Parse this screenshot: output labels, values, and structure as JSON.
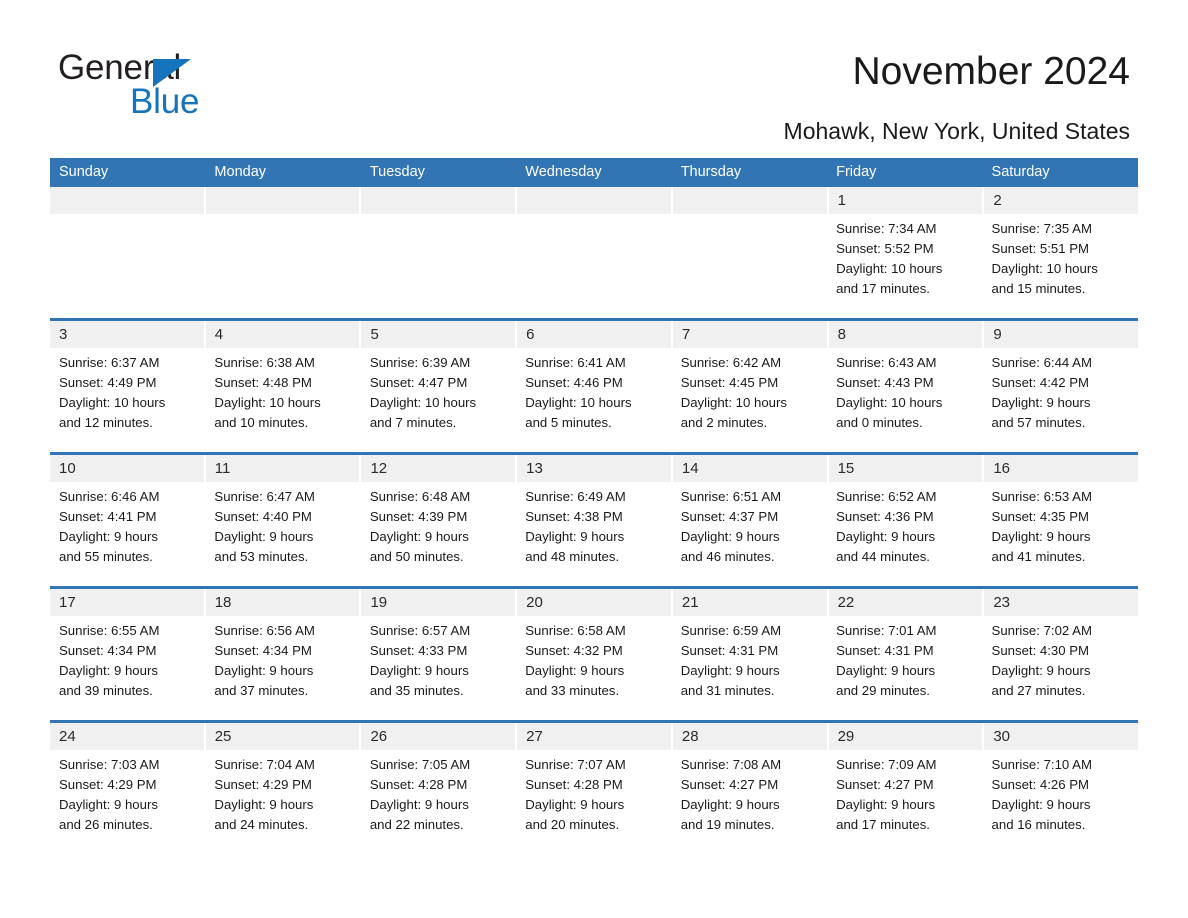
{
  "logo": {
    "primary_text": "General",
    "secondary_text": "Blue",
    "triangle_icon": "triangle-icon",
    "primary_color": "#231f20",
    "secondary_color": "#1574bb"
  },
  "header": {
    "title": "November 2024",
    "subtitle": "Mohawk, New York, United States"
  },
  "colors": {
    "header_blue": "#3275b5",
    "date_band": "#f0f0f0",
    "cell_background": "#ffffff",
    "text": "#1a1a1a"
  },
  "weekdays": [
    "Sunday",
    "Monday",
    "Tuesday",
    "Wednesday",
    "Thursday",
    "Friday",
    "Saturday"
  ],
  "weeks": [
    {
      "days": [
        {
          "date": "",
          "empty": true,
          "sunrise": "",
          "sunset": "",
          "daylight_1": "",
          "daylight_2": ""
        },
        {
          "date": "",
          "empty": true,
          "sunrise": "",
          "sunset": "",
          "daylight_1": "",
          "daylight_2": ""
        },
        {
          "date": "",
          "empty": true,
          "sunrise": "",
          "sunset": "",
          "daylight_1": "",
          "daylight_2": ""
        },
        {
          "date": "",
          "empty": true,
          "sunrise": "",
          "sunset": "",
          "daylight_1": "",
          "daylight_2": ""
        },
        {
          "date": "",
          "empty": true,
          "sunrise": "",
          "sunset": "",
          "daylight_1": "",
          "daylight_2": ""
        },
        {
          "date": "1",
          "empty": false,
          "sunrise": "Sunrise: 7:34 AM",
          "sunset": "Sunset: 5:52 PM",
          "daylight_1": "Daylight: 10 hours",
          "daylight_2": "and 17 minutes."
        },
        {
          "date": "2",
          "empty": false,
          "sunrise": "Sunrise: 7:35 AM",
          "sunset": "Sunset: 5:51 PM",
          "daylight_1": "Daylight: 10 hours",
          "daylight_2": "and 15 minutes."
        }
      ]
    },
    {
      "days": [
        {
          "date": "3",
          "empty": false,
          "sunrise": "Sunrise: 6:37 AM",
          "sunset": "Sunset: 4:49 PM",
          "daylight_1": "Daylight: 10 hours",
          "daylight_2": "and 12 minutes."
        },
        {
          "date": "4",
          "empty": false,
          "sunrise": "Sunrise: 6:38 AM",
          "sunset": "Sunset: 4:48 PM",
          "daylight_1": "Daylight: 10 hours",
          "daylight_2": "and 10 minutes."
        },
        {
          "date": "5",
          "empty": false,
          "sunrise": "Sunrise: 6:39 AM",
          "sunset": "Sunset: 4:47 PM",
          "daylight_1": "Daylight: 10 hours",
          "daylight_2": "and 7 minutes."
        },
        {
          "date": "6",
          "empty": false,
          "sunrise": "Sunrise: 6:41 AM",
          "sunset": "Sunset: 4:46 PM",
          "daylight_1": "Daylight: 10 hours",
          "daylight_2": "and 5 minutes."
        },
        {
          "date": "7",
          "empty": false,
          "sunrise": "Sunrise: 6:42 AM",
          "sunset": "Sunset: 4:45 PM",
          "daylight_1": "Daylight: 10 hours",
          "daylight_2": "and 2 minutes."
        },
        {
          "date": "8",
          "empty": false,
          "sunrise": "Sunrise: 6:43 AM",
          "sunset": "Sunset: 4:43 PM",
          "daylight_1": "Daylight: 10 hours",
          "daylight_2": "and 0 minutes."
        },
        {
          "date": "9",
          "empty": false,
          "sunrise": "Sunrise: 6:44 AM",
          "sunset": "Sunset: 4:42 PM",
          "daylight_1": "Daylight: 9 hours",
          "daylight_2": "and 57 minutes."
        }
      ]
    },
    {
      "days": [
        {
          "date": "10",
          "empty": false,
          "sunrise": "Sunrise: 6:46 AM",
          "sunset": "Sunset: 4:41 PM",
          "daylight_1": "Daylight: 9 hours",
          "daylight_2": "and 55 minutes."
        },
        {
          "date": "11",
          "empty": false,
          "sunrise": "Sunrise: 6:47 AM",
          "sunset": "Sunset: 4:40 PM",
          "daylight_1": "Daylight: 9 hours",
          "daylight_2": "and 53 minutes."
        },
        {
          "date": "12",
          "empty": false,
          "sunrise": "Sunrise: 6:48 AM",
          "sunset": "Sunset: 4:39 PM",
          "daylight_1": "Daylight: 9 hours",
          "daylight_2": "and 50 minutes."
        },
        {
          "date": "13",
          "empty": false,
          "sunrise": "Sunrise: 6:49 AM",
          "sunset": "Sunset: 4:38 PM",
          "daylight_1": "Daylight: 9 hours",
          "daylight_2": "and 48 minutes."
        },
        {
          "date": "14",
          "empty": false,
          "sunrise": "Sunrise: 6:51 AM",
          "sunset": "Sunset: 4:37 PM",
          "daylight_1": "Daylight: 9 hours",
          "daylight_2": "and 46 minutes."
        },
        {
          "date": "15",
          "empty": false,
          "sunrise": "Sunrise: 6:52 AM",
          "sunset": "Sunset: 4:36 PM",
          "daylight_1": "Daylight: 9 hours",
          "daylight_2": "and 44 minutes."
        },
        {
          "date": "16",
          "empty": false,
          "sunrise": "Sunrise: 6:53 AM",
          "sunset": "Sunset: 4:35 PM",
          "daylight_1": "Daylight: 9 hours",
          "daylight_2": "and 41 minutes."
        }
      ]
    },
    {
      "days": [
        {
          "date": "17",
          "empty": false,
          "sunrise": "Sunrise: 6:55 AM",
          "sunset": "Sunset: 4:34 PM",
          "daylight_1": "Daylight: 9 hours",
          "daylight_2": "and 39 minutes."
        },
        {
          "date": "18",
          "empty": false,
          "sunrise": "Sunrise: 6:56 AM",
          "sunset": "Sunset: 4:34 PM",
          "daylight_1": "Daylight: 9 hours",
          "daylight_2": "and 37 minutes."
        },
        {
          "date": "19",
          "empty": false,
          "sunrise": "Sunrise: 6:57 AM",
          "sunset": "Sunset: 4:33 PM",
          "daylight_1": "Daylight: 9 hours",
          "daylight_2": "and 35 minutes."
        },
        {
          "date": "20",
          "empty": false,
          "sunrise": "Sunrise: 6:58 AM",
          "sunset": "Sunset: 4:32 PM",
          "daylight_1": "Daylight: 9 hours",
          "daylight_2": "and 33 minutes."
        },
        {
          "date": "21",
          "empty": false,
          "sunrise": "Sunrise: 6:59 AM",
          "sunset": "Sunset: 4:31 PM",
          "daylight_1": "Daylight: 9 hours",
          "daylight_2": "and 31 minutes."
        },
        {
          "date": "22",
          "empty": false,
          "sunrise": "Sunrise: 7:01 AM",
          "sunset": "Sunset: 4:31 PM",
          "daylight_1": "Daylight: 9 hours",
          "daylight_2": "and 29 minutes."
        },
        {
          "date": "23",
          "empty": false,
          "sunrise": "Sunrise: 7:02 AM",
          "sunset": "Sunset: 4:30 PM",
          "daylight_1": "Daylight: 9 hours",
          "daylight_2": "and 27 minutes."
        }
      ]
    },
    {
      "days": [
        {
          "date": "24",
          "empty": false,
          "sunrise": "Sunrise: 7:03 AM",
          "sunset": "Sunset: 4:29 PM",
          "daylight_1": "Daylight: 9 hours",
          "daylight_2": "and 26 minutes."
        },
        {
          "date": "25",
          "empty": false,
          "sunrise": "Sunrise: 7:04 AM",
          "sunset": "Sunset: 4:29 PM",
          "daylight_1": "Daylight: 9 hours",
          "daylight_2": "and 24 minutes."
        },
        {
          "date": "26",
          "empty": false,
          "sunrise": "Sunrise: 7:05 AM",
          "sunset": "Sunset: 4:28 PM",
          "daylight_1": "Daylight: 9 hours",
          "daylight_2": "and 22 minutes."
        },
        {
          "date": "27",
          "empty": false,
          "sunrise": "Sunrise: 7:07 AM",
          "sunset": "Sunset: 4:28 PM",
          "daylight_1": "Daylight: 9 hours",
          "daylight_2": "and 20 minutes."
        },
        {
          "date": "28",
          "empty": false,
          "sunrise": "Sunrise: 7:08 AM",
          "sunset": "Sunset: 4:27 PM",
          "daylight_1": "Daylight: 9 hours",
          "daylight_2": "and 19 minutes."
        },
        {
          "date": "29",
          "empty": false,
          "sunrise": "Sunrise: 7:09 AM",
          "sunset": "Sunset: 4:27 PM",
          "daylight_1": "Daylight: 9 hours",
          "daylight_2": "and 17 minutes."
        },
        {
          "date": "30",
          "empty": false,
          "sunrise": "Sunrise: 7:10 AM",
          "sunset": "Sunset: 4:26 PM",
          "daylight_1": "Daylight: 9 hours",
          "daylight_2": "and 16 minutes."
        }
      ]
    }
  ]
}
